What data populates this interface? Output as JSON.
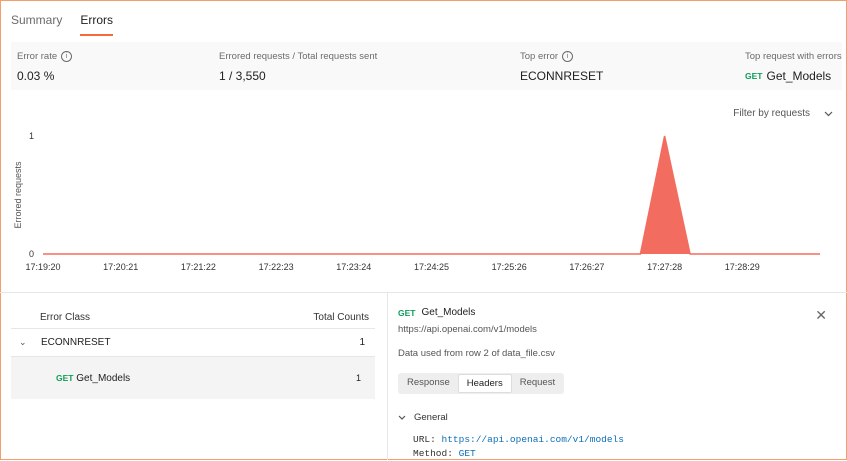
{
  "tabs": [
    {
      "label": "Summary"
    },
    {
      "label": "Errors"
    }
  ],
  "stats": {
    "error_rate": {
      "label": "Error rate",
      "value": "0.03 %"
    },
    "errored_requests": {
      "label": "Errored requests / Total requests sent",
      "value": "1 / 3,550"
    },
    "top_error": {
      "label": "Top error",
      "value": "ECONNRESET"
    },
    "top_request": {
      "label": "Top request with errors",
      "method": "GET",
      "value": "Get_Models"
    }
  },
  "filter": {
    "label": "Filter by requests"
  },
  "chart_data": {
    "type": "area",
    "ylabel": "Errored requests",
    "ylim": [
      0,
      1
    ],
    "yticks": [
      "0",
      "1"
    ],
    "xticks": [
      "17:19:20",
      "17:20:21",
      "17:21:22",
      "17:22:23",
      "17:23:24",
      "17:24:25",
      "17:25:26",
      "17:26:27",
      "17:27:28",
      "17:28:29"
    ],
    "series": [
      {
        "x": [
          "17:19:20",
          "17:27:09",
          "17:27:28",
          "17:27:48",
          "17:29:30"
        ],
        "values": [
          0,
          0,
          1,
          0,
          0
        ]
      }
    ],
    "color": "#f26d5f"
  },
  "error_table": {
    "headers": {
      "class": "Error Class",
      "counts": "Total Counts"
    },
    "group": {
      "name": "ECONNRESET",
      "count": "1"
    },
    "item": {
      "method": "GET",
      "name": "Get_Models",
      "count": "1"
    }
  },
  "detail": {
    "method": "GET",
    "name": "Get_Models",
    "url": "https://api.openai.com/v1/models",
    "note": "Data used from row 2 of data_file.csv",
    "tabs": [
      "Response",
      "Headers",
      "Request"
    ],
    "active_tab": "Headers",
    "section": "General",
    "url_key": "URL:",
    "url_value": "https://api.openai.com/v1/models",
    "method_key": "Method:",
    "method_value": "GET"
  },
  "colors": {
    "accent": "#f26b3a",
    "get_method": "#0f9d58",
    "link": "#0e6fb8"
  }
}
